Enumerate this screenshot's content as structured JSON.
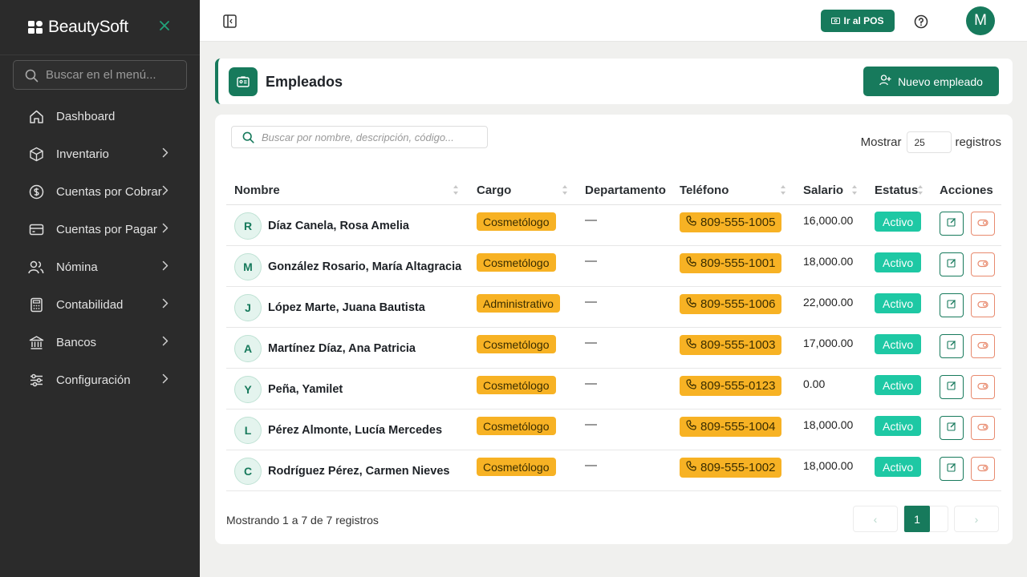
{
  "app": {
    "name": "BeautySoft"
  },
  "sidebar": {
    "search_placeholder": "Buscar en el menú...",
    "items": [
      {
        "label": "Dashboard",
        "icon": "home-icon",
        "has_submenu": false
      },
      {
        "label": "Inventario",
        "icon": "box-icon",
        "has_submenu": true
      },
      {
        "label": "Cuentas por Cobrar",
        "icon": "dollar-circle-icon",
        "has_submenu": true
      },
      {
        "label": "Cuentas por Pagar",
        "icon": "credit-card-icon",
        "has_submenu": true
      },
      {
        "label": "Nómina",
        "icon": "users-icon",
        "has_submenu": true
      },
      {
        "label": "Contabilidad",
        "icon": "calculator-icon",
        "has_submenu": true
      },
      {
        "label": "Bancos",
        "icon": "bank-icon",
        "has_submenu": true
      },
      {
        "label": "Configuración",
        "icon": "sliders-icon",
        "has_submenu": true
      }
    ]
  },
  "topbar": {
    "pos_label": "Ir al POS",
    "avatar_initial": "M"
  },
  "page": {
    "title": "Empleados",
    "new_button_label": "Nuevo empleado"
  },
  "table": {
    "search_placeholder": "Buscar por nombre, descripción, código...",
    "show_label": "Mostrar",
    "page_size": "25",
    "records_label": "registros",
    "columns": [
      "Nombre",
      "Cargo",
      "Departamento",
      "Teléfono",
      "Salario",
      "Estatus",
      "Acciones"
    ],
    "rows": [
      {
        "initial": "R",
        "name": "Díaz Canela, Rosa Amelia",
        "cargo": "Cosmetólogo",
        "departamento": "—",
        "telefono": "809-555-1005",
        "salario": "16,000.00",
        "estatus": "Activo"
      },
      {
        "initial": "M",
        "name": "González Rosario, María Altagracia",
        "cargo": "Cosmetólogo",
        "departamento": "—",
        "telefono": "809-555-1001",
        "salario": "18,000.00",
        "estatus": "Activo"
      },
      {
        "initial": "J",
        "name": "López Marte, Juana Bautista",
        "cargo": "Administrativo",
        "departamento": "—",
        "telefono": "809-555-1006",
        "salario": "22,000.00",
        "estatus": "Activo"
      },
      {
        "initial": "A",
        "name": "Martínez Díaz, Ana Patricia",
        "cargo": "Cosmetólogo",
        "departamento": "—",
        "telefono": "809-555-1003",
        "salario": "17,000.00",
        "estatus": "Activo"
      },
      {
        "initial": "Y",
        "name": "Peña, Yamilet",
        "cargo": "Cosmetólogo",
        "departamento": "—",
        "telefono": "809-555-0123",
        "salario": "0.00",
        "estatus": "Activo"
      },
      {
        "initial": "L",
        "name": "Pérez Almonte, Lucía Mercedes",
        "cargo": "Cosmetólogo",
        "departamento": "—",
        "telefono": "809-555-1004",
        "salario": "18,000.00",
        "estatus": "Activo"
      },
      {
        "initial": "C",
        "name": "Rodríguez Pérez, Carmen Nieves",
        "cargo": "Cosmetólogo",
        "departamento": "—",
        "telefono": "809-555-1002",
        "salario": "18,000.00",
        "estatus": "Activo"
      }
    ],
    "footer_info": "Mostrando 1 a 7 de 7 registros",
    "pagination": {
      "prev": "‹",
      "current": "1",
      "next": "›"
    }
  },
  "colors": {
    "accent": "#177a5c",
    "sidebar_bg": "#2b2b2b",
    "badge_amber": "#f7b224",
    "status_teal": "#1ec8a4",
    "delete_outline": "#e88a6e"
  }
}
